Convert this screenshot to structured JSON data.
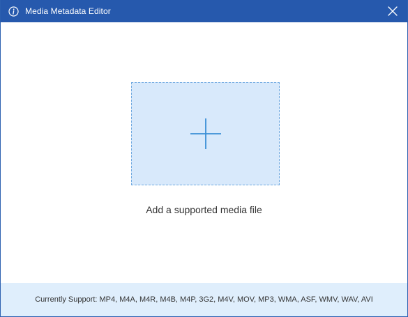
{
  "window": {
    "title": "Media Metadata Editor",
    "accent_color": "#2659ad"
  },
  "icons": {
    "info": "info-icon",
    "close": "close-icon",
    "plus": "plus-icon"
  },
  "drop_zone": {
    "label": "Add a supported media file",
    "fill_color": "#d8e9fb",
    "border_color": "#6ea8e0"
  },
  "footer": {
    "support_text": "Currently Support: MP4, M4A, M4R, M4B, M4P, 3G2, M4V, MOV, MP3, WMA, ASF, WMV, WAV, AVI"
  }
}
